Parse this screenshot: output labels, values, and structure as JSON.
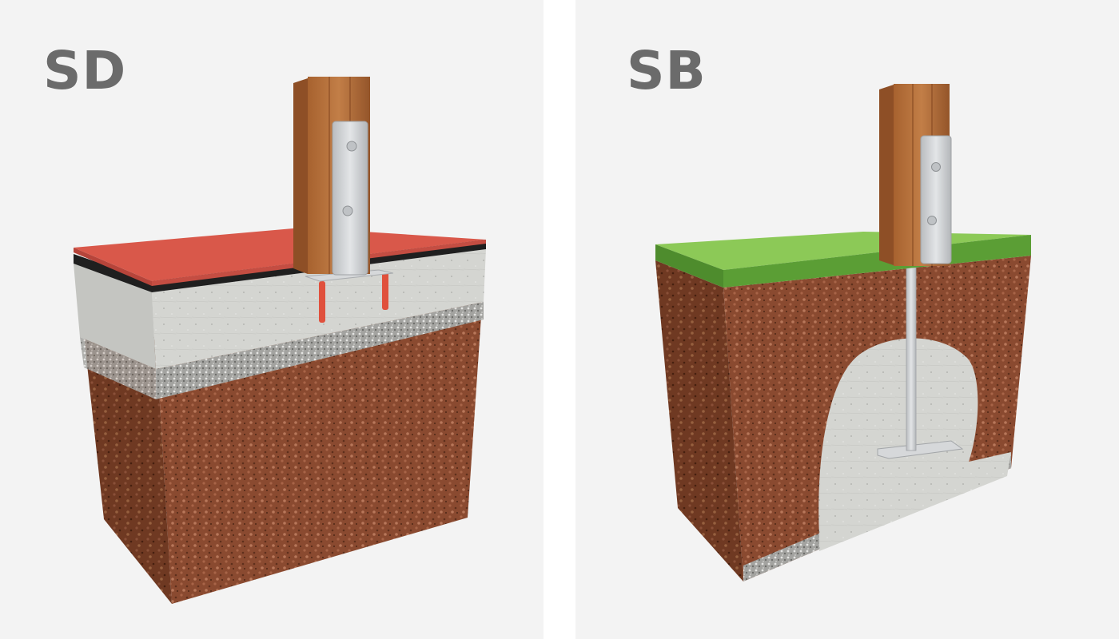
{
  "panels": [
    {
      "id": "sd",
      "label": "SD"
    },
    {
      "id": "sb",
      "label": "SB"
    }
  ],
  "colors": {
    "background": "#f3f3f3",
    "label": "#6b6b6b",
    "soil": "#8a4a30",
    "concrete": "#cfd0cc",
    "gravel": "#9b9b98",
    "paving": "#d9584a",
    "grass": "#7fbf4d",
    "timber": "#b5713d",
    "steel": "#cfd2d4",
    "anchor": "#e0503c"
  }
}
